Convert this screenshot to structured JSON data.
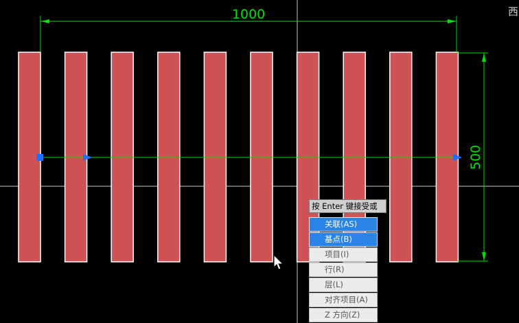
{
  "dimension_horizontal": {
    "text": "1000"
  },
  "dimension_vertical": {
    "text": "500"
  },
  "corner_text": "西",
  "prompt": {
    "text": "按 Enter 键接受或"
  },
  "menu": {
    "items": [
      {
        "label": "关联(AS)",
        "state": "highlighted"
      },
      {
        "label": "基点(B)",
        "state": "highlighted"
      },
      {
        "label": "项目(I)",
        "state": "normal"
      },
      {
        "label": "行(R)",
        "state": "normal"
      },
      {
        "label": "层(L)",
        "state": "normal"
      },
      {
        "label": "对齐项目(A)",
        "state": "normal"
      },
      {
        "label": "Z 方向(Z)",
        "state": "normal"
      }
    ]
  },
  "colors": {
    "background": "#000000",
    "bar_fill": "#cf5255",
    "bar_outline": "#ffffff",
    "dimension": "#00e000",
    "crosshair": "#cccccc",
    "grip": "#1e6fff"
  },
  "array_bar_count": 10
}
